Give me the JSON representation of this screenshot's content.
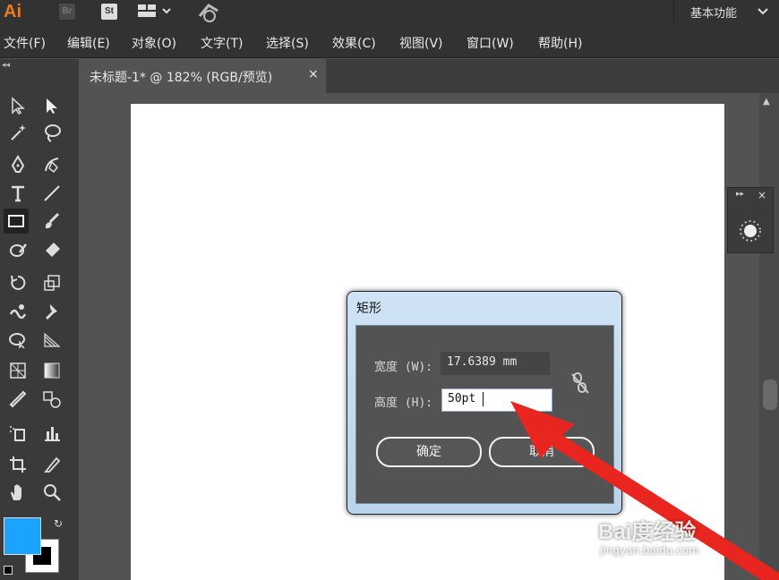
{
  "app": {
    "logo": "Ai",
    "badge_br": "Br",
    "badge_st": "St",
    "workspace": "基本功能"
  },
  "menu": [
    "文件(F)",
    "编辑(E)",
    "对象(O)",
    "文字(T)",
    "选择(S)",
    "效果(C)",
    "视图(V)",
    "窗口(W)",
    "帮助(H)"
  ],
  "document": {
    "tab_title": "未标题-1* @ 182% (RGB/预览)",
    "tab_close": "×"
  },
  "tools": [
    "selection-tool",
    "direct-selection-tool",
    "magic-wand-tool",
    "lasso-tool",
    "pen-tool",
    "curvature-tool",
    "type-tool",
    "line-tool",
    "rectangle-tool",
    "paintbrush-tool",
    "shaper-tool",
    "eraser-tool",
    "rotate-tool",
    "scale-tool",
    "warp-tool",
    "puppet-warp-tool",
    "free-transform-tool",
    "perspective-grid-tool",
    "mesh-tool",
    "gradient-tool",
    "eyedropper-tool",
    "blend-tool",
    "symbol-sprayer-tool",
    "graph-tool",
    "artboard-tool",
    "slice-tool",
    "hand-tool",
    "zoom-tool"
  ],
  "colors": {
    "fill": "#1aa3ff",
    "stroke": "#000000",
    "arrow": "#e8251f"
  },
  "dialog": {
    "title": "矩形",
    "width_label": "宽度 (W):",
    "width_value": "17.6389 mm",
    "height_label": "高度 (H):",
    "height_value": "50pt",
    "ok_label": "确定",
    "cancel_label": "取消"
  },
  "watermark": {
    "brand": "Bai度经验",
    "url": "jingyan.baidu.com"
  }
}
